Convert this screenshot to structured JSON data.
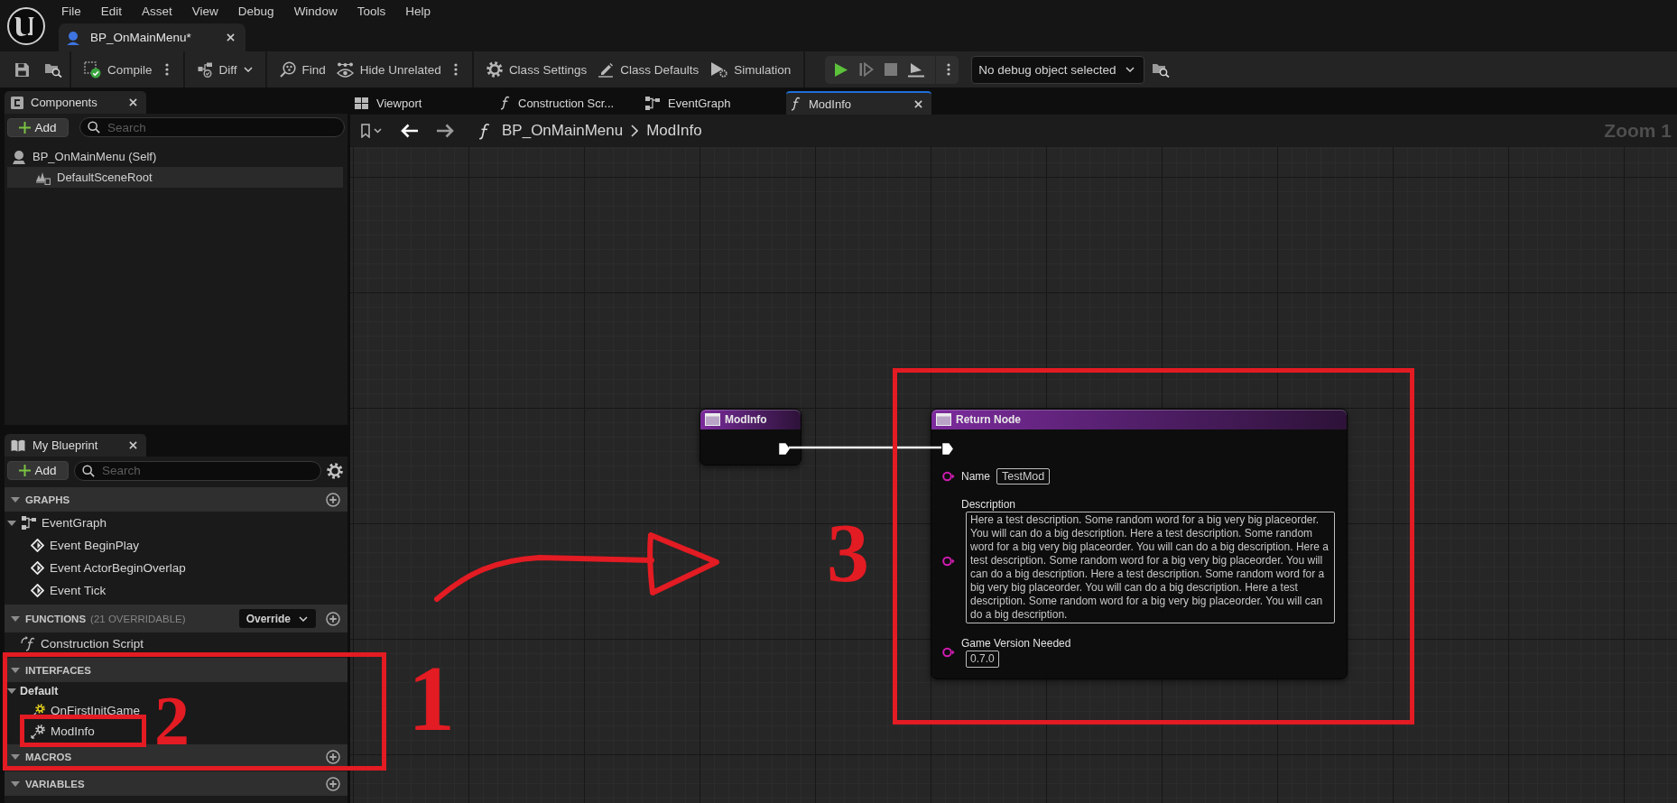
{
  "menu_bar": {
    "items": [
      "File",
      "Edit",
      "Asset",
      "View",
      "Debug",
      "Window",
      "Tools",
      "Help"
    ]
  },
  "document_tabs": [
    {
      "label": "BP_OnMainMenu*",
      "selected": true
    }
  ],
  "toolbar": {
    "buttons": [
      {
        "label": "Compile",
        "kind": "split"
      },
      {
        "label": "Diff",
        "kind": "dropdown"
      },
      {
        "label": "Find",
        "kind": "plain"
      },
      {
        "label": "Hide Unrelated",
        "kind": "split"
      },
      {
        "label": "Class Settings",
        "kind": "plain"
      },
      {
        "label": "Class Defaults",
        "kind": "plain"
      },
      {
        "label": "Simulation",
        "kind": "plain"
      }
    ],
    "debug_object": {
      "value": "No debug object selected"
    }
  },
  "components_panel": {
    "title": "Components",
    "add_button": "Add",
    "search": {
      "placeholder": "Search"
    },
    "tree": [
      {
        "label": "BP_OnMainMenu (Self)",
        "selected": false,
        "children": [
          {
            "label": "DefaultSceneRoot",
            "selected": true
          }
        ]
      }
    ]
  },
  "my_blueprint_panel": {
    "title": "My Blueprint",
    "add_button": "Add",
    "search": {
      "placeholder": "Search"
    },
    "sections": [
      {
        "title": "GRAPHS",
        "expanded": true,
        "add": true,
        "items": [
          {
            "label": "EventGraph",
            "kind": "graph",
            "expanded": true,
            "children": [
              {
                "label": "Event BeginPlay",
                "kind": "event"
              },
              {
                "label": "Event ActorBeginOverlap",
                "kind": "event"
              },
              {
                "label": "Event Tick",
                "kind": "event"
              }
            ]
          }
        ]
      },
      {
        "title": "FUNCTIONS",
        "note": "(21 OVERRIDABLE)",
        "dropdown": "Override",
        "expanded": true,
        "add": true,
        "items": [
          {
            "label": "Construction Script",
            "kind": "function"
          }
        ]
      },
      {
        "title": "INTERFACES",
        "expanded": true,
        "add": false,
        "items": [
          {
            "label": "Default",
            "kind": "category",
            "expanded": true,
            "children": [
              {
                "label": "OnFirstInitGame",
                "kind": "interface_event"
              },
              {
                "label": "ModInfo",
                "kind": "interface_function"
              }
            ]
          }
        ]
      },
      {
        "title": "MACROS",
        "expanded": true,
        "add": true
      },
      {
        "title": "VARIABLES",
        "expanded": true,
        "add": true
      }
    ]
  },
  "graph_tabs": [
    {
      "label": "Viewport",
      "kind": "viewport",
      "selected": false
    },
    {
      "label": "Construction Scr...",
      "kind": "function",
      "selected": false
    },
    {
      "label": "EventGraph",
      "kind": "graph",
      "selected": false
    },
    {
      "label": "ModInfo",
      "kind": "function",
      "selected": true
    }
  ],
  "breadcrumb": {
    "path": [
      "BP_OnMainMenu",
      "ModInfo"
    ],
    "zoom": "Zoom 1"
  },
  "nodes": [
    {
      "kind": "entry",
      "title": "ModInfo",
      "pins": [
        {
          "kind": "exec",
          "connected": true
        }
      ]
    },
    {
      "kind": "result",
      "title": "Return Node",
      "pins": [
        {
          "kind": "exec",
          "connected": true
        },
        {
          "kind": "name",
          "label": "Name",
          "value": "TestMod",
          "connected": false
        },
        {
          "kind": "text",
          "label": "Description",
          "value": "Here a test description. Some random word for a big very big placeorder. You will can do a big description. Here a test description. Some random word for a big very big placeorder. You will can do a big description. Here a test description. Some random word for a big very big placeorder. You will can do a big description. Here a test description. Some random word for a big very big placeorder. You will can do a big description. Here a test description. Some random word for a big very big placeorder. You will can do a big description.",
          "connected": false
        },
        {
          "kind": "text",
          "label": "Game Version Needed",
          "value": "0.7.0",
          "connected": false
        }
      ]
    }
  ],
  "annotations": [
    {
      "kind": "box"
    },
    {
      "kind": "number",
      "text": "1"
    },
    {
      "kind": "box"
    },
    {
      "kind": "number",
      "text": "2"
    },
    {
      "kind": "arrow"
    },
    {
      "kind": "number",
      "text": "3"
    },
    {
      "kind": "box"
    }
  ]
}
